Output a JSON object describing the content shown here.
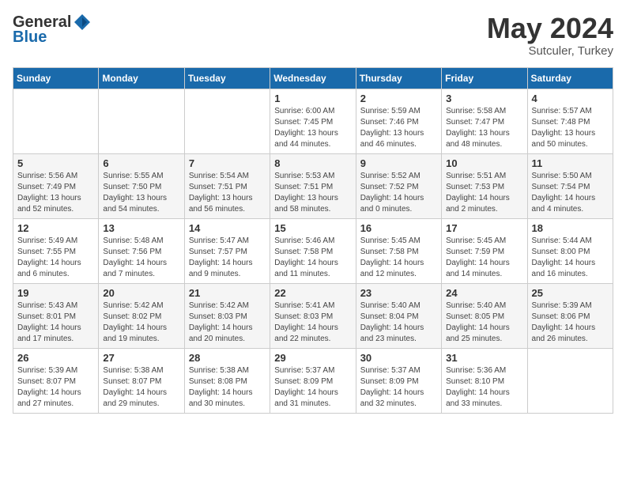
{
  "header": {
    "logo_general": "General",
    "logo_blue": "Blue",
    "title": "May 2024",
    "subtitle": "Sutculer, Turkey"
  },
  "days_of_week": [
    "Sunday",
    "Monday",
    "Tuesday",
    "Wednesday",
    "Thursday",
    "Friday",
    "Saturday"
  ],
  "weeks": [
    {
      "row_alt": false,
      "days": [
        {
          "num": "",
          "info": ""
        },
        {
          "num": "",
          "info": ""
        },
        {
          "num": "",
          "info": ""
        },
        {
          "num": "1",
          "info": "Sunrise: 6:00 AM\nSunset: 7:45 PM\nDaylight: 13 hours\nand 44 minutes."
        },
        {
          "num": "2",
          "info": "Sunrise: 5:59 AM\nSunset: 7:46 PM\nDaylight: 13 hours\nand 46 minutes."
        },
        {
          "num": "3",
          "info": "Sunrise: 5:58 AM\nSunset: 7:47 PM\nDaylight: 13 hours\nand 48 minutes."
        },
        {
          "num": "4",
          "info": "Sunrise: 5:57 AM\nSunset: 7:48 PM\nDaylight: 13 hours\nand 50 minutes."
        }
      ]
    },
    {
      "row_alt": true,
      "days": [
        {
          "num": "5",
          "info": "Sunrise: 5:56 AM\nSunset: 7:49 PM\nDaylight: 13 hours\nand 52 minutes."
        },
        {
          "num": "6",
          "info": "Sunrise: 5:55 AM\nSunset: 7:50 PM\nDaylight: 13 hours\nand 54 minutes."
        },
        {
          "num": "7",
          "info": "Sunrise: 5:54 AM\nSunset: 7:51 PM\nDaylight: 13 hours\nand 56 minutes."
        },
        {
          "num": "8",
          "info": "Sunrise: 5:53 AM\nSunset: 7:51 PM\nDaylight: 13 hours\nand 58 minutes."
        },
        {
          "num": "9",
          "info": "Sunrise: 5:52 AM\nSunset: 7:52 PM\nDaylight: 14 hours\nand 0 minutes."
        },
        {
          "num": "10",
          "info": "Sunrise: 5:51 AM\nSunset: 7:53 PM\nDaylight: 14 hours\nand 2 minutes."
        },
        {
          "num": "11",
          "info": "Sunrise: 5:50 AM\nSunset: 7:54 PM\nDaylight: 14 hours\nand 4 minutes."
        }
      ]
    },
    {
      "row_alt": false,
      "days": [
        {
          "num": "12",
          "info": "Sunrise: 5:49 AM\nSunset: 7:55 PM\nDaylight: 14 hours\nand 6 minutes."
        },
        {
          "num": "13",
          "info": "Sunrise: 5:48 AM\nSunset: 7:56 PM\nDaylight: 14 hours\nand 7 minutes."
        },
        {
          "num": "14",
          "info": "Sunrise: 5:47 AM\nSunset: 7:57 PM\nDaylight: 14 hours\nand 9 minutes."
        },
        {
          "num": "15",
          "info": "Sunrise: 5:46 AM\nSunset: 7:58 PM\nDaylight: 14 hours\nand 11 minutes."
        },
        {
          "num": "16",
          "info": "Sunrise: 5:45 AM\nSunset: 7:58 PM\nDaylight: 14 hours\nand 12 minutes."
        },
        {
          "num": "17",
          "info": "Sunrise: 5:45 AM\nSunset: 7:59 PM\nDaylight: 14 hours\nand 14 minutes."
        },
        {
          "num": "18",
          "info": "Sunrise: 5:44 AM\nSunset: 8:00 PM\nDaylight: 14 hours\nand 16 minutes."
        }
      ]
    },
    {
      "row_alt": true,
      "days": [
        {
          "num": "19",
          "info": "Sunrise: 5:43 AM\nSunset: 8:01 PM\nDaylight: 14 hours\nand 17 minutes."
        },
        {
          "num": "20",
          "info": "Sunrise: 5:42 AM\nSunset: 8:02 PM\nDaylight: 14 hours\nand 19 minutes."
        },
        {
          "num": "21",
          "info": "Sunrise: 5:42 AM\nSunset: 8:03 PM\nDaylight: 14 hours\nand 20 minutes."
        },
        {
          "num": "22",
          "info": "Sunrise: 5:41 AM\nSunset: 8:03 PM\nDaylight: 14 hours\nand 22 minutes."
        },
        {
          "num": "23",
          "info": "Sunrise: 5:40 AM\nSunset: 8:04 PM\nDaylight: 14 hours\nand 23 minutes."
        },
        {
          "num": "24",
          "info": "Sunrise: 5:40 AM\nSunset: 8:05 PM\nDaylight: 14 hours\nand 25 minutes."
        },
        {
          "num": "25",
          "info": "Sunrise: 5:39 AM\nSunset: 8:06 PM\nDaylight: 14 hours\nand 26 minutes."
        }
      ]
    },
    {
      "row_alt": false,
      "days": [
        {
          "num": "26",
          "info": "Sunrise: 5:39 AM\nSunset: 8:07 PM\nDaylight: 14 hours\nand 27 minutes."
        },
        {
          "num": "27",
          "info": "Sunrise: 5:38 AM\nSunset: 8:07 PM\nDaylight: 14 hours\nand 29 minutes."
        },
        {
          "num": "28",
          "info": "Sunrise: 5:38 AM\nSunset: 8:08 PM\nDaylight: 14 hours\nand 30 minutes."
        },
        {
          "num": "29",
          "info": "Sunrise: 5:37 AM\nSunset: 8:09 PM\nDaylight: 14 hours\nand 31 minutes."
        },
        {
          "num": "30",
          "info": "Sunrise: 5:37 AM\nSunset: 8:09 PM\nDaylight: 14 hours\nand 32 minutes."
        },
        {
          "num": "31",
          "info": "Sunrise: 5:36 AM\nSunset: 8:10 PM\nDaylight: 14 hours\nand 33 minutes."
        },
        {
          "num": "",
          "info": ""
        }
      ]
    }
  ]
}
